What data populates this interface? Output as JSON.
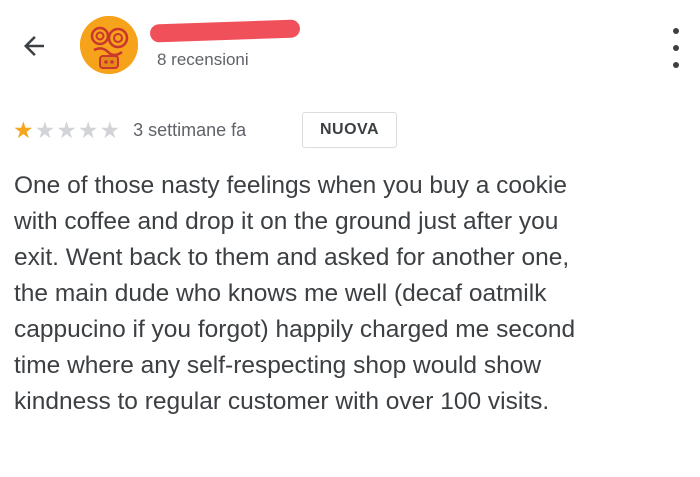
{
  "header": {
    "back_icon": "arrow-left-icon",
    "avatar_icon": "avatar-illustration",
    "reviewer_name": "",
    "review_count": "8 recensioni",
    "more_icon": "more-vertical-icon"
  },
  "review": {
    "rating": 1,
    "max_rating": 5,
    "time_ago": "3 settimane fa",
    "badge": "NUOVA",
    "text": "One of those nasty feelings when you buy a cookie\nwith coffee and drop it on the ground just after you\nexit. Went back to them and asked for another one,\nthe main dude who knows me well (decaf oatmilk\ncappucino if you forgot) happily charged me second\ntime where any self-respecting shop would show\nkindness to regular customer with over 100 visits."
  },
  "colors": {
    "star_filled": "#f4a61f",
    "star_empty": "#d2d4d7",
    "avatar_bg": "#f7a21b",
    "redaction": "#f0505a"
  }
}
